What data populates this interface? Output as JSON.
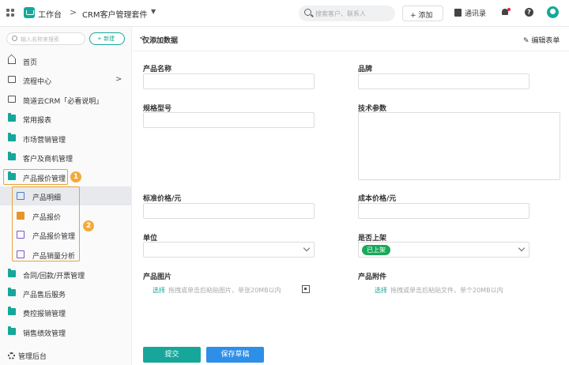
{
  "header": {
    "workspace": "工作台",
    "separator": ">",
    "app_title": "CRM客户管理套件",
    "search_placeholder": "搜索客户、联系人",
    "add_label": "+ 添加",
    "contacts_label": "通讯录",
    "help_label": "?"
  },
  "sidebar": {
    "search_placeholder": "输入名称来搜索",
    "new_label": "+ 新建",
    "items": [
      {
        "label": "首页",
        "icon": "home-icon"
      },
      {
        "label": "流程中心",
        "icon": "flow-icon",
        "chevron": ">"
      },
      {
        "label": "简道云CRM「必看说明」",
        "icon": "document-icon"
      },
      {
        "label": "常用报表",
        "icon": "folder-icon"
      },
      {
        "label": "市场营销管理",
        "icon": "folder-icon"
      },
      {
        "label": "客户及商机管理",
        "icon": "folder-icon"
      },
      {
        "label": "产品报价管理",
        "icon": "folder-icon"
      },
      {
        "label": "合同/回款/开票管理",
        "icon": "folder-icon"
      },
      {
        "label": "产品售后服务",
        "icon": "folder-icon"
      },
      {
        "label": "费控报销管理",
        "icon": "folder-icon"
      },
      {
        "label": "销售绩效管理",
        "icon": "folder-icon"
      }
    ],
    "sub_items": [
      {
        "label": "产品明细",
        "icon": "form-icon"
      },
      {
        "label": "产品报价",
        "icon": "quote-icon"
      },
      {
        "label": "产品报价管理",
        "icon": "dashboard-icon"
      },
      {
        "label": "产品销量分析",
        "icon": "dashboard-icon"
      }
    ],
    "badge1": "1",
    "badge2": "2",
    "footer": "管理后台"
  },
  "main": {
    "back": "<",
    "title": "仅添加数据",
    "edit_form": "编辑表单",
    "fields": {
      "name": "产品名称",
      "brand": "品牌",
      "spec": "规格型号",
      "tech": "技术参数",
      "std_price": "标准价格/元",
      "cost_price": "成本价格/元",
      "unit": "单位",
      "on_shelf": "是否上架",
      "on_shelf_value": "已上架",
      "image": "产品图片",
      "attachment": "产品附件"
    },
    "upload_pick": "选择",
    "image_hint": "拖拽或单击后粘贴图片，单张20MB以内",
    "file_hint": "拖拽或单击后粘贴文件，单个20MB以内",
    "submit": "提交",
    "save_draft": "保存草稿"
  },
  "colors": {
    "brand": "#16a79a",
    "draft": "#2d8fe8",
    "tag": "#1aa85a",
    "highlight": "#e8a33a"
  }
}
